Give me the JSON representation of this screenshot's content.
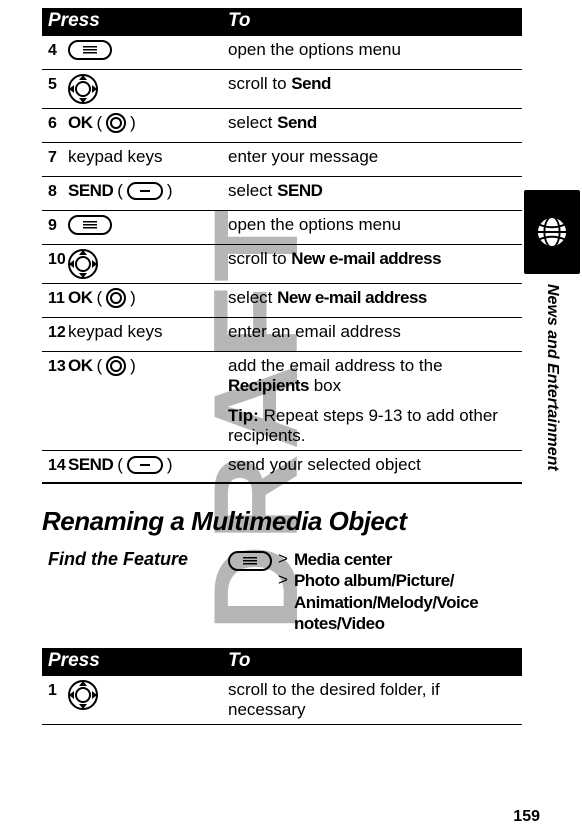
{
  "watermark": "DRAFT",
  "header1": {
    "press": "Press",
    "to": "To"
  },
  "steps1": [
    {
      "num": "4",
      "press_type": "menu",
      "to": "open the options menu"
    },
    {
      "num": "5",
      "press_type": "nav",
      "to_pre": "scroll to ",
      "to_bold": "Send"
    },
    {
      "num": "6",
      "press_type": "ok",
      "press_label": "OK",
      "to_pre": "select ",
      "to_bold": "Send"
    },
    {
      "num": "7",
      "press_text": "keypad keys",
      "to": "enter your message"
    },
    {
      "num": "8",
      "press_type": "softkey",
      "press_label": "SEND",
      "to_pre": "select ",
      "to_bold": "SEND"
    },
    {
      "num": "9",
      "press_type": "menu",
      "to": "open the options menu"
    },
    {
      "num": "10",
      "press_type": "nav",
      "to_pre": "scroll to ",
      "to_bold": "New e-mail address"
    },
    {
      "num": "11",
      "press_type": "ok",
      "press_label": "OK",
      "to_pre": "select ",
      "to_bold": "New e-mail address"
    },
    {
      "num": "12",
      "press_text": "keypad keys",
      "to": "enter an email address"
    },
    {
      "num": "13",
      "press_type": "ok",
      "press_label": "OK",
      "to_multi_pre": "add the email address to the ",
      "to_multi_bold": "Recipients",
      "to_multi_post": " box",
      "tip_label": "Tip:",
      "tip_text": " Repeat steps 9-13 to add other recipients."
    },
    {
      "num": "14",
      "press_type": "softkey",
      "press_label": "SEND",
      "to": "send your selected object"
    }
  ],
  "section_title": "Renaming a Multimedia Object",
  "find_feature": {
    "label": "Find the Feature",
    "line1": "Media center",
    "line2": "Photo album/Picture/",
    "line3": "Animation/Melody/Voice",
    "line4": "notes/Video"
  },
  "header2": {
    "press": "Press",
    "to": "To"
  },
  "steps2": [
    {
      "num": "1",
      "press_type": "nav",
      "to": "scroll to the desired folder, if necessary"
    }
  ],
  "side_label": "News and Entertainment",
  "page_number": "159",
  "paren_open": "(",
  "paren_close": ")",
  "gt": ">"
}
